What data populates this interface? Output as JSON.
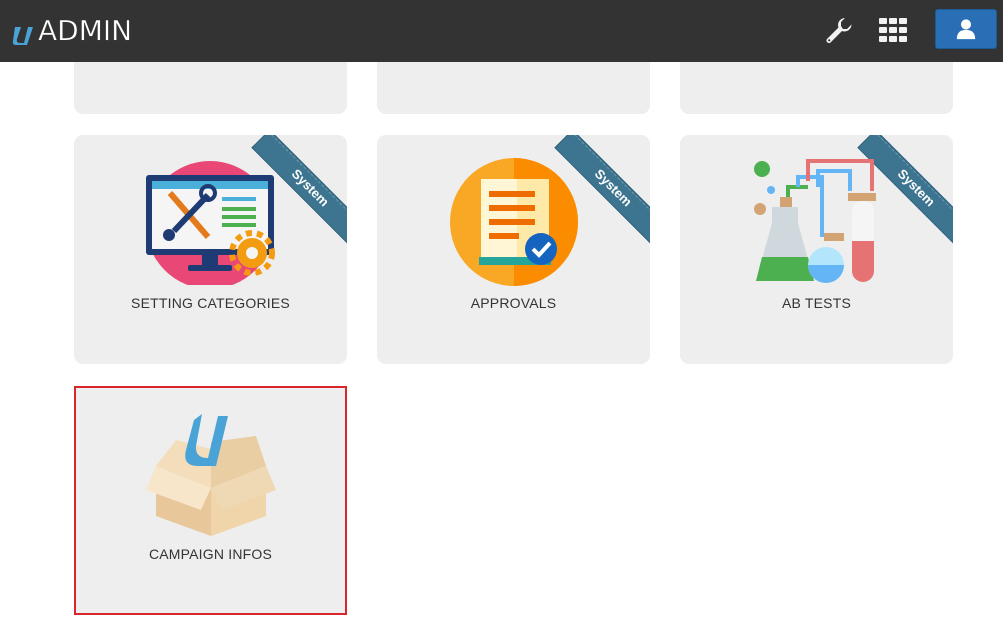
{
  "header": {
    "logo_text": "ADMIN",
    "logo_mark_icon": "u-logo-icon",
    "tools_icon": "wrench-icon",
    "apps_icon": "grid-apps-icon",
    "user_icon": "user-icon",
    "accent_color": "#2a6fb5"
  },
  "tiles_row0": [
    {
      "label": ""
    },
    {
      "label": ""
    },
    {
      "label": ""
    }
  ],
  "tiles": [
    {
      "label": "SETTING CATEGORIES",
      "badge": "System",
      "icon": "settings-monitor-icon"
    },
    {
      "label": "APPROVALS",
      "badge": "System",
      "icon": "approval-document-icon"
    },
    {
      "label": "AB TESTS",
      "badge": "System",
      "icon": "lab-flasks-icon"
    },
    {
      "label": "CAMPAIGN INFOS",
      "badge": "",
      "icon": "box-icon"
    }
  ],
  "colors": {
    "ribbon": "#3d7590",
    "selection_border": "#d9262b",
    "tile_background": "#eeeeee"
  }
}
